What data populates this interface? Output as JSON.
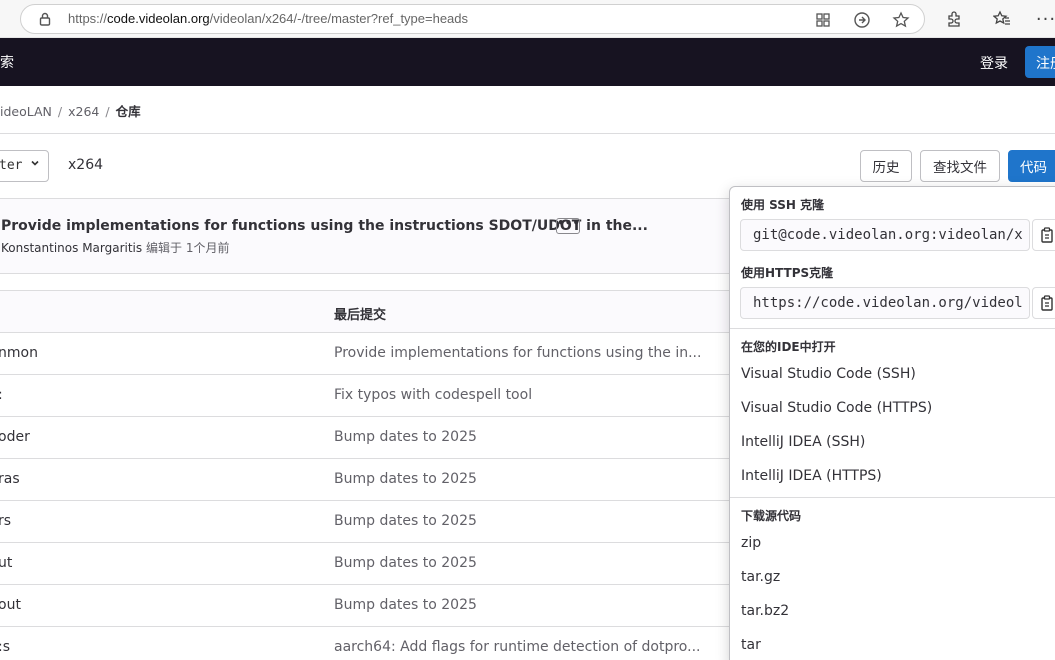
{
  "browser": {
    "url_prefix": "https://",
    "url_host": "code.videolan.org",
    "url_path": "/videolan/x264/-/tree/master?ref_type=heads"
  },
  "topnav": {
    "search_fragment": "索",
    "login": "登录",
    "register": "注册"
  },
  "breadcrumb": {
    "items": [
      "ideoLAN",
      "x264",
      "仓库"
    ],
    "separator": "/"
  },
  "toolbar": {
    "branch": "ter",
    "path": "x264",
    "history": "历史",
    "find_file": "查找文件",
    "code": "代码"
  },
  "last_commit": {
    "title": "Provide implementations for functions using the instructions SDOT/UDOT in the...",
    "more": "•••",
    "author": "Konstantinos Margaritis",
    "action": "编辑于",
    "time": "1个月前"
  },
  "table": {
    "header_last_commit": "最后提交",
    "rows": [
      {
        "name": "nmon",
        "message": "Provide implementations for functions using the in..."
      },
      {
        "name": ":",
        "message": "Fix typos with codespell tool"
      },
      {
        "name": "oder",
        "message": "Bump dates to 2025"
      },
      {
        "name": "ras",
        "message": "Bump dates to 2025"
      },
      {
        "name": "rs",
        "message": "Bump dates to 2025"
      },
      {
        "name": "ut",
        "message": "Bump dates to 2025"
      },
      {
        "name": "out",
        "message": "Bump dates to 2025"
      },
      {
        "name": ":s",
        "message": "aarch64: Add flags for runtime detection of dotpro..."
      }
    ]
  },
  "clone_dropdown": {
    "ssh_title": "使用 SSH 克隆",
    "ssh_url": "git@code.videolan.org:videolan/x",
    "https_title": "使用HTTPS克隆",
    "https_url": "https://code.videolan.org/videol",
    "ide_title": "在您的IDE中打开",
    "ide_items": [
      "Visual Studio Code (SSH)",
      "Visual Studio Code (HTTPS)",
      "IntelliJ IDEA (SSH)",
      "IntelliJ IDEA (HTTPS)"
    ],
    "download_title": "下载源代码",
    "download_items": [
      "zip",
      "tar.gz",
      "tar.bz2",
      "tar"
    ]
  },
  "colors": {
    "nav_bg": "#171321",
    "primary": "#1f75cb"
  }
}
